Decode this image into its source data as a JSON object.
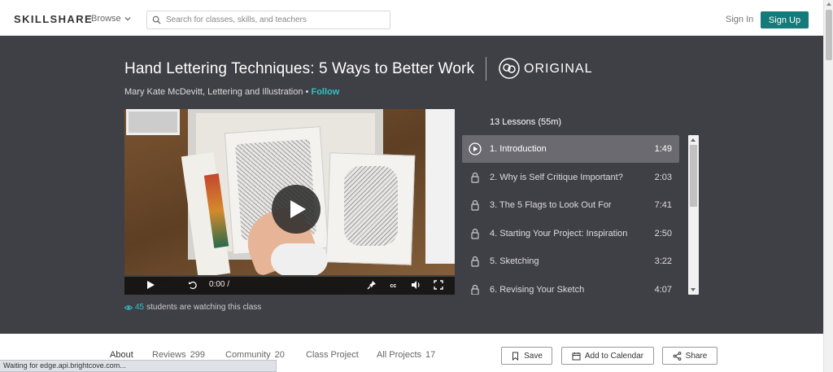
{
  "nav": {
    "logo": "SKILLSHARE",
    "browse": "Browse",
    "search_placeholder": "Search for classes, skills, and teachers",
    "signin": "Sign In",
    "signup": "Sign Up"
  },
  "course": {
    "title": "Hand Lettering Techniques: 5 Ways to Better Work",
    "badge": "ORIGINAL",
    "author": "Mary Kate McDevitt, Lettering and Illustration",
    "separator": "•",
    "follow": "Follow"
  },
  "video": {
    "time": "0:00 /",
    "watching_count": "45",
    "watching_text": "students are watching this class"
  },
  "lessons": {
    "header": "13 Lessons (55m)",
    "items": [
      {
        "name": "1. Introduction",
        "duration": "1:49",
        "active": true
      },
      {
        "name": "2. Why is Self Critique Important?",
        "duration": "2:03",
        "active": false
      },
      {
        "name": "3. The 5 Flags to Look Out For",
        "duration": "7:41",
        "active": false
      },
      {
        "name": "4. Starting Your Project: Inspiration",
        "duration": "2:50",
        "active": false
      },
      {
        "name": "5. Sketching",
        "duration": "3:22",
        "active": false
      },
      {
        "name": "6. Revising Your Sketch",
        "duration": "4:07",
        "active": false
      }
    ]
  },
  "tabs": {
    "about": "About",
    "reviews": "Reviews",
    "reviews_count": "299",
    "community": "Community",
    "community_count": "20",
    "class_project": "Class Project",
    "all_projects": "All Projects",
    "all_projects_count": "17"
  },
  "actions": {
    "save": "Save",
    "calendar": "Add to Calendar",
    "share": "Share"
  },
  "status": "Waiting for edge.api.brightcove.com...",
  "colors": {
    "hero_bg": "#3f3f46",
    "accent": "#2fc2c4",
    "signup_bg": "#157a7a"
  }
}
